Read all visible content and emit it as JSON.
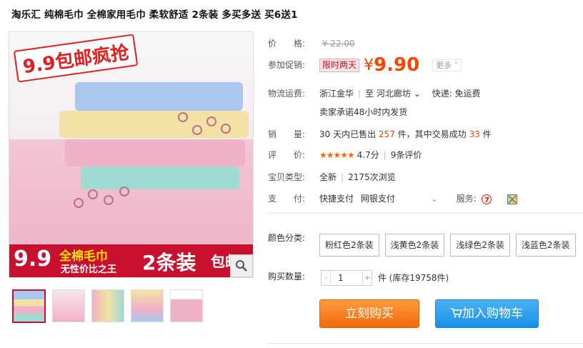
{
  "title": "淘乐汇 纯棉毛巾 全棉家用毛巾 柔软舒适 2条装 多买多送 买6送1",
  "image": {
    "banner_top": "9.9包邮疯抢",
    "banner_bottom_big": "9.9",
    "banner_bottom_line1": "全棉毛巾",
    "banner_bottom_line2": "无性价比之王",
    "banner_bottom_pack": "2条装",
    "banner_bottom_free": "包邮"
  },
  "price": {
    "label": "价　　格:",
    "original": "¥ 22.00"
  },
  "promo": {
    "label": "参加促销:",
    "tag": "限时两天",
    "currency": "¥",
    "value": "9.90",
    "more": "更多"
  },
  "shipping": {
    "label": "物流运费:",
    "from": "浙江金华",
    "sep": "至",
    "to": "河北廊坊",
    "express": "快递: 免运费",
    "promise": "卖家承诺48小时内发货"
  },
  "sales": {
    "label": "销　　量:",
    "prefix": "30 天内已售出",
    "sold": "257",
    "mid": "件，其中交易成功",
    "success": "33",
    "suffix": "件"
  },
  "rating": {
    "label": "评　　价:",
    "stars": "★★★★★",
    "score": "4.7分",
    "count": "9条评价"
  },
  "type": {
    "label": "宝贝类型:",
    "condition": "全新",
    "views": "2175次浏览"
  },
  "payment": {
    "label": "支　　付:",
    "method1": "快捷支付",
    "method2": "网银支付",
    "service_label": "服务:"
  },
  "sku": {
    "label": "颜色分类:",
    "options": [
      "粉红色2条装",
      "浅黄色2条装",
      "浅绿色2条装",
      "浅蓝色2条装"
    ]
  },
  "quantity": {
    "label": "购买数量:",
    "value": "1",
    "minus": "-",
    "plus": "+",
    "stock": "件 (库存19758件)"
  },
  "actions": {
    "buy_now": "立刻购买",
    "add_cart": "加入购物车"
  },
  "colors": {
    "price": "#ff4400",
    "buy": "#f06a0a",
    "cart": "#1890e6",
    "promo_red": "#c8102e"
  }
}
